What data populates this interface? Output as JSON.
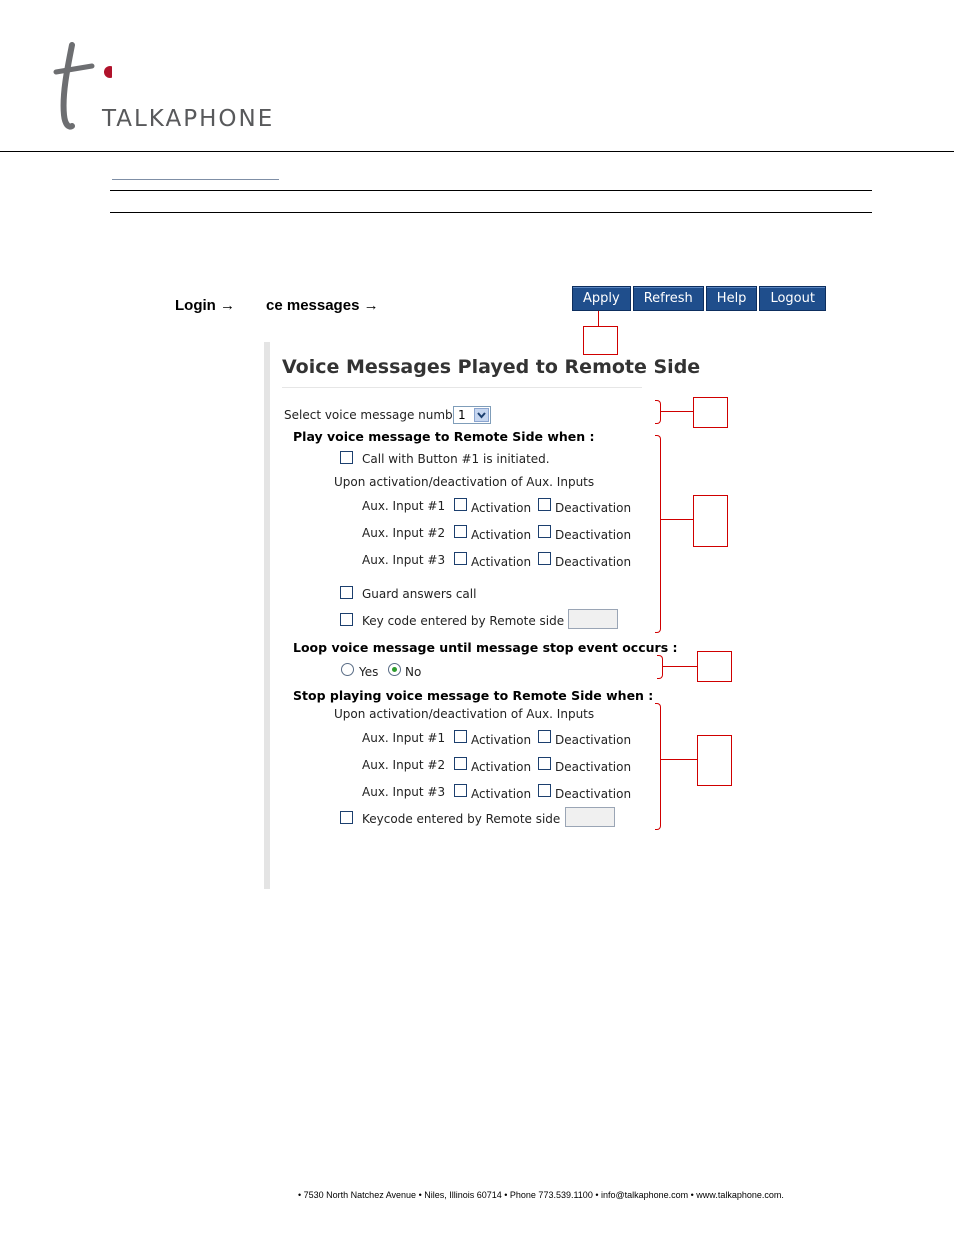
{
  "logo": {
    "brand": "TALKAPHONE"
  },
  "breadcrumb": {
    "login": "Login →",
    "voice": "ce messages →"
  },
  "toolbar": {
    "apply": "Apply",
    "refresh": "Refresh",
    "help": "Help",
    "logout": "Logout"
  },
  "panel": {
    "title": "Voice Messages Played to Remote Side",
    "select_label": "Select voice message number",
    "select_value": "1",
    "play_heading": "Play voice message to Remote Side when :",
    "call_button": "Call with Button #1 is initiated.",
    "aux_intro": "Upon activation/deactivation of Aux. Inputs",
    "aux_inputs": [
      "Aux. Input #1",
      "Aux. Input #2",
      "Aux. Input #3"
    ],
    "activation": "Activation",
    "deactivation": "Deactivation",
    "guard": "Guard answers call",
    "keycode": "Key code entered by Remote side is",
    "loop_heading": "Loop voice message until message stop event occurs :",
    "yes": "Yes",
    "no": "No",
    "stop_heading": "Stop playing voice message to Remote Side when :",
    "stop_aux_intro": "Upon activation/deactivation of Aux. Inputs",
    "stop_keycode": "Keycode entered by Remote side is"
  },
  "footer": {
    "text": "• 7530 North Natchez Avenue • Niles, Illinois 60714 • Phone 773.539.1100 • info@talkaphone.com • www.talkaphone.com."
  }
}
